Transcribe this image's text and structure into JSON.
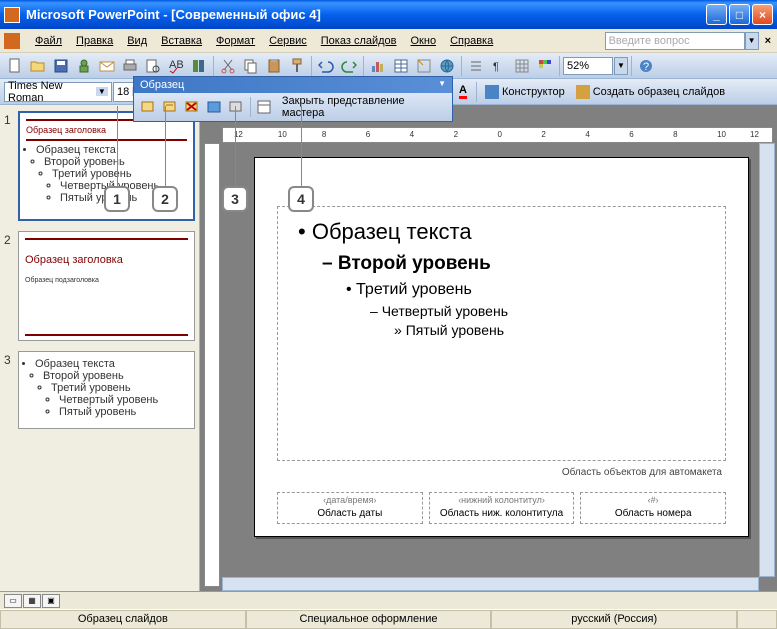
{
  "title": "Microsoft PowerPoint - [Современный офис 4]",
  "menu": [
    "Файл",
    "Правка",
    "Вид",
    "Вставка",
    "Формат",
    "Сервис",
    "Показ слайдов",
    "Окно",
    "Справка"
  ],
  "question_placeholder": "Введите вопрос",
  "zoom": "52%",
  "font_name": "Times New Roman",
  "font_size": "18",
  "designer_btn": "Конструктор",
  "create_master_btn": "Создать образец слайдов",
  "master_toolbar": {
    "title": "Образец",
    "close": "Закрыть представление мастера"
  },
  "callouts": [
    "1",
    "2",
    "3",
    "4"
  ],
  "thumbs": {
    "t1": {
      "title": "Образец заголовка",
      "sub": "Образец текста",
      "lvls": [
        "Второй уровень",
        "Третий уровень",
        "Четвертый уровень",
        "Пятый уровень"
      ]
    },
    "t2": {
      "title": "Образец заголовка",
      "sub": "Образец подзаголовка"
    },
    "t3": {
      "sub": "Образец текста",
      "lvls": [
        "Второй уровень",
        "Третий уровень",
        "Четвертый уровень",
        "Пятый уровень"
      ]
    }
  },
  "slide": {
    "l1": "Образец текста",
    "l2": "Второй уровень",
    "l3": "Третий уровень",
    "l4": "Четвертый уровень",
    "l5": "Пятый уровень",
    "auto": "Область объектов для автомакета",
    "foot": [
      {
        "top": "‹дата/время›",
        "bot": "Область даты"
      },
      {
        "top": "‹нижний колонтитул›",
        "bot": "Область ниж. колонтитула"
      },
      {
        "top": "‹#›",
        "bot": "Область номера"
      }
    ]
  },
  "ruler_labels": [
    "12",
    "10",
    "8",
    "6",
    "4",
    "2",
    "0",
    "2",
    "4",
    "6",
    "8",
    "10",
    "12"
  ],
  "status": [
    "Образец слайдов",
    "Специальное оформление",
    "русский (Россия)"
  ]
}
